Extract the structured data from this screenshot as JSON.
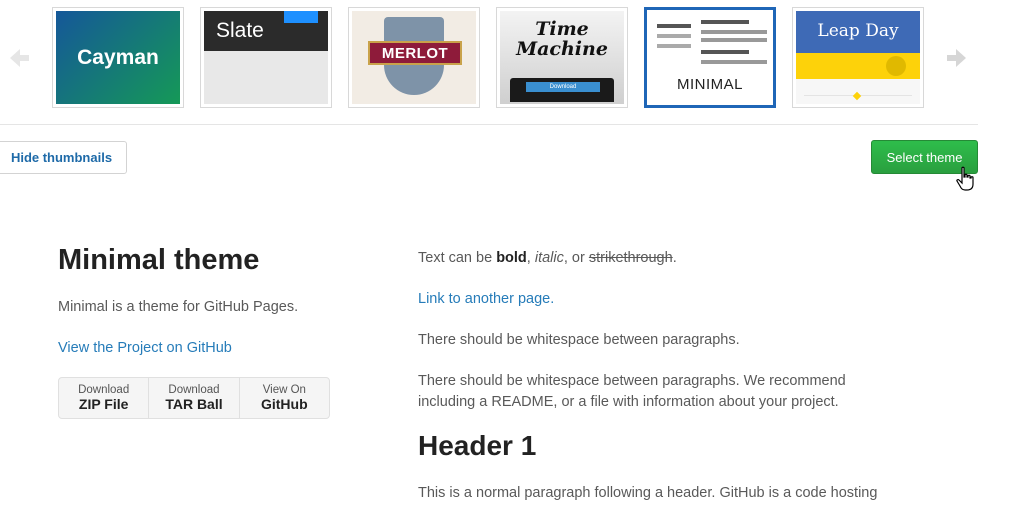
{
  "themes": [
    {
      "name": "Cayman",
      "label": "Cayman"
    },
    {
      "name": "Slate",
      "label": "Slate"
    },
    {
      "name": "Merlot",
      "label": "MERLOT"
    },
    {
      "name": "Time Machine",
      "label": "Time Machine",
      "button": "Download"
    },
    {
      "name": "Minimal",
      "label": "MINIMAL",
      "selected": true
    },
    {
      "name": "Leap Day",
      "label": "Leap Day"
    }
  ],
  "controls": {
    "hide_thumbnails": "Hide thumbnails",
    "select_theme": "Select theme"
  },
  "preview": {
    "title": "Minimal theme",
    "description": "Minimal is a theme for GitHub Pages.",
    "project_link": "View the Project on GitHub",
    "downloads": [
      {
        "small": "Download",
        "big": "ZIP File"
      },
      {
        "small": "Download",
        "big": "TAR Ball"
      },
      {
        "small": "View On",
        "big": "GitHub"
      }
    ],
    "text_prefix": "Text can be ",
    "bold": "bold",
    "sep1": ", ",
    "italic": "italic",
    "sep2": ", or ",
    "strike": "strikethrough",
    "end": ".",
    "link_page": "Link to another page.",
    "para1": "There should be whitespace between paragraphs.",
    "para2": "There should be whitespace between paragraphs. We recommend including a README, or a file with information about your project.",
    "header1": "Header 1",
    "para3": "This is a normal paragraph following a header. GitHub is a code hosting"
  },
  "colors": {
    "link": "#267cb9",
    "select_green": "#2ebd4b",
    "selected_border": "#1f66b7"
  }
}
